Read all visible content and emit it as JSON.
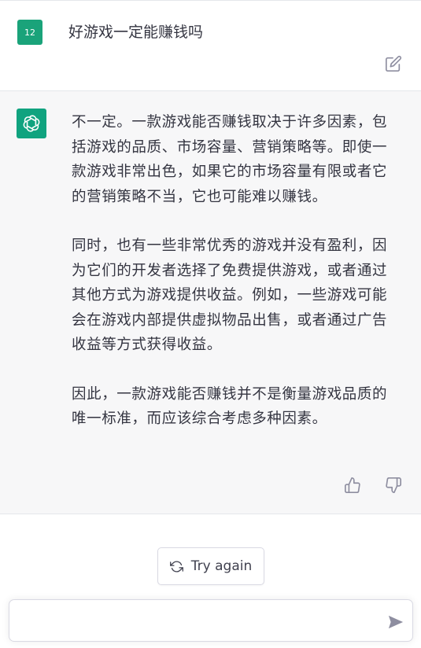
{
  "user_message": {
    "avatar_label": "12",
    "text": "好游戏一定能赚钱吗",
    "icons": {
      "edit": "edit-icon"
    }
  },
  "assistant_message": {
    "avatar_icon": "openai-logo-icon",
    "paragraphs": [
      "不一定。一款游戏能否赚钱取决于许多因素，包括游戏的品质、市场容量、营销策略等。即使一款游戏非常出色，如果它的市场容量有限或者它的营销策略不当，它也可能难以赚钱。",
      "同时，也有一些非常优秀的游戏并没有盈利，因为它们的开发者选择了免费提供游戏，或者通过其他方式为游戏提供收益。例如，一些游戏可能会在游戏内部提供虚拟物品出售，或者通过广告收益等方式获得收益。",
      "因此，一款游戏能否赚钱并不是衡量游戏品质的唯一标准，而应该综合考虑多种因素。"
    ],
    "icons": {
      "like": "thumbs-up-icon",
      "dislike": "thumbs-down-icon"
    }
  },
  "controls": {
    "try_again_label": "Try again",
    "input_value": "",
    "icons": {
      "refresh": "refresh-icon",
      "send": "send-icon"
    }
  },
  "colors": {
    "brand": "#10a37f",
    "user_avatar": "#1aa37a",
    "assistant_background": "#f7f7f8",
    "text": "#343541"
  }
}
